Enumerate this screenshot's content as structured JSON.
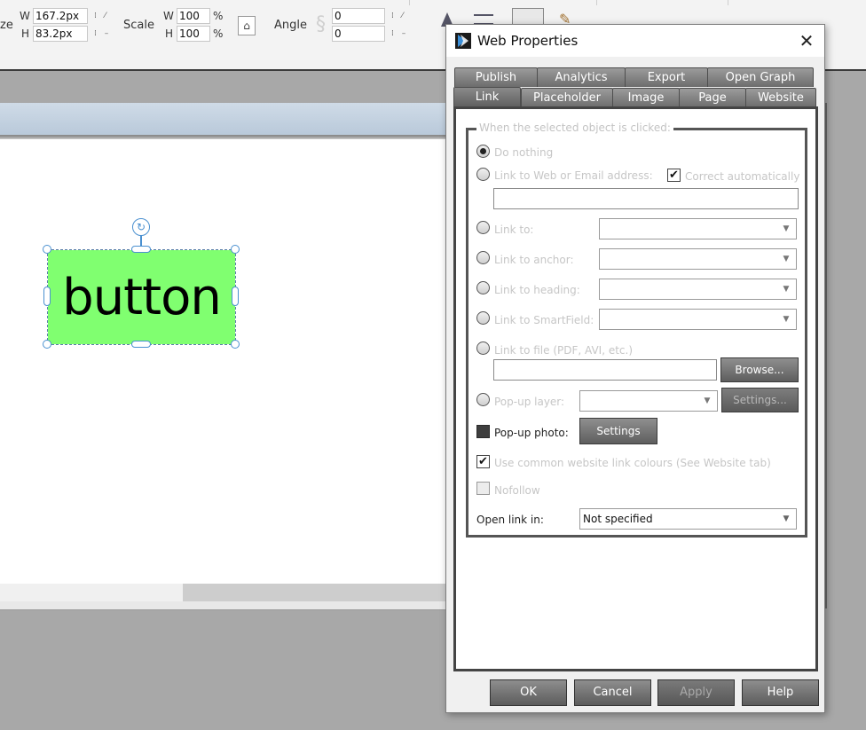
{
  "toolbar": {
    "size_label": "ze",
    "w_label": "W",
    "w_value": "167.2px",
    "h_label": "H",
    "h_value": "83.2px",
    "scale_label": "Scale",
    "scale_w_label": "W",
    "scale_w_value": "100",
    "scale_h_label": "H",
    "scale_h_value": "100",
    "percent": "%",
    "angle_label": "Angle",
    "angle_value_1": "0",
    "angle_value_2": "0"
  },
  "canvas": {
    "object_text": "button",
    "object_color": "#80ff70"
  },
  "dialog": {
    "title": "Web Properties",
    "close_glyph": "✕",
    "tabs_back": [
      {
        "label": "Publish"
      },
      {
        "label": "Analytics"
      },
      {
        "label": "Export"
      },
      {
        "label": "Open Graph"
      }
    ],
    "tabs_front": [
      {
        "label": "Link",
        "active": true
      },
      {
        "label": "Placeholder"
      },
      {
        "label": "Image"
      },
      {
        "label": "Page"
      },
      {
        "label": "Website"
      }
    ],
    "group_title": "When the selected object is clicked:",
    "options": {
      "do_nothing": "Do nothing",
      "link_web": "Link to Web or Email address:",
      "correct_auto": "Correct automatically",
      "link_to": "Link to:",
      "link_anchor": "Link to anchor:",
      "link_heading": "Link to heading:",
      "link_smartfield": "Link to SmartField:",
      "link_file": "Link to file (PDF, AVI, etc.)",
      "browse": "Browse...",
      "popup_layer": "Pop-up layer:",
      "popup_layer_settings": "Settings...",
      "popup_photo": "Pop-up photo:",
      "popup_photo_settings": "Settings",
      "common_colours": "Use common website link colours (See Website tab)",
      "nofollow": "Nofollow",
      "open_link_in": "Open link in:",
      "open_link_value": "Not specified"
    },
    "buttons": {
      "ok": "OK",
      "cancel": "Cancel",
      "apply": "Apply",
      "help": "Help"
    }
  }
}
